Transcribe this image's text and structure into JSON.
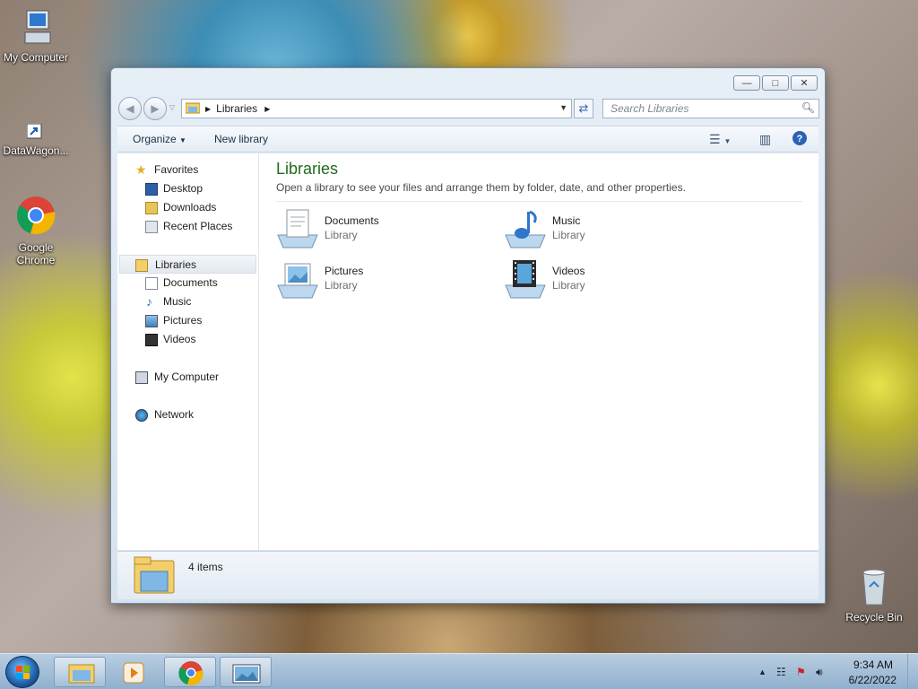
{
  "desktop": {
    "icons": [
      {
        "label": "My Computer"
      },
      {
        "label": "DataWagon..."
      },
      {
        "label": "Google Chrome"
      },
      {
        "label": "Recycle Bin"
      }
    ]
  },
  "window": {
    "address": {
      "crumb": "Libraries"
    },
    "search": {
      "placeholder": "Search Libraries"
    },
    "toolbar": {
      "organize": "Organize",
      "new_library": "New library"
    },
    "nav": {
      "favorites": {
        "label": "Favorites",
        "items": [
          "Desktop",
          "Downloads",
          "Recent Places"
        ]
      },
      "libraries": {
        "label": "Libraries",
        "items": [
          "Documents",
          "Music",
          "Pictures",
          "Videos"
        ]
      },
      "my_computer": "My Computer",
      "network": "Network"
    },
    "main": {
      "title": "Libraries",
      "subtitle": "Open a library to see your files and arrange them by folder, date, and other properties.",
      "libraries": [
        {
          "name": "Documents",
          "type": "Library"
        },
        {
          "name": "Music",
          "type": "Library"
        },
        {
          "name": "Pictures",
          "type": "Library"
        },
        {
          "name": "Videos",
          "type": "Library"
        }
      ]
    },
    "details": {
      "count": "4 items"
    }
  },
  "taskbar": {
    "time": "9:34 AM",
    "date": "6/22/2022"
  }
}
